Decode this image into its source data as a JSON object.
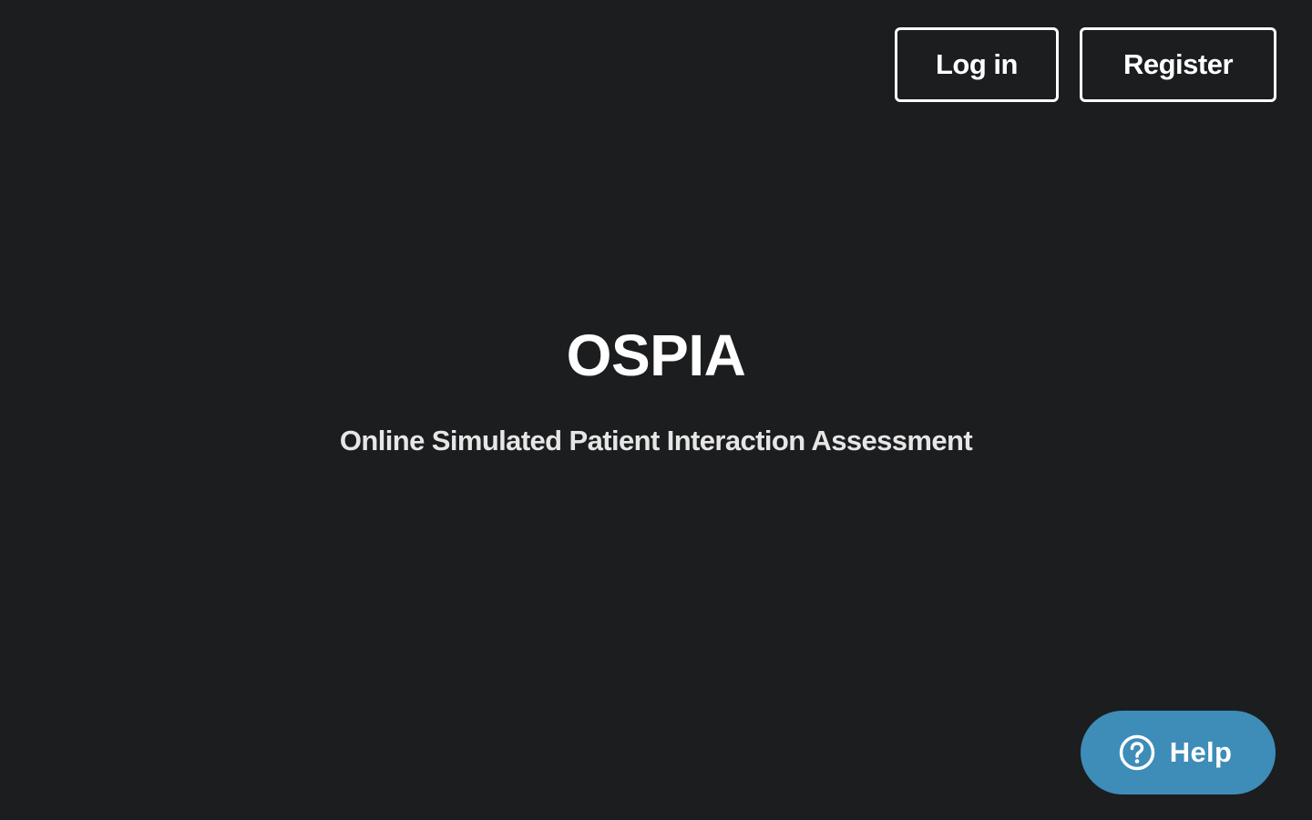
{
  "header": {
    "login_label": "Log in",
    "register_label": "Register"
  },
  "hero": {
    "title": "OSPIA",
    "subtitle": "Online Simulated Patient Interaction Assessment"
  },
  "help": {
    "label": "Help",
    "icon": "question-circle-icon"
  },
  "colors": {
    "background": "#1c1d1f",
    "text": "#ffffff",
    "help_button": "#3e8cb8"
  }
}
